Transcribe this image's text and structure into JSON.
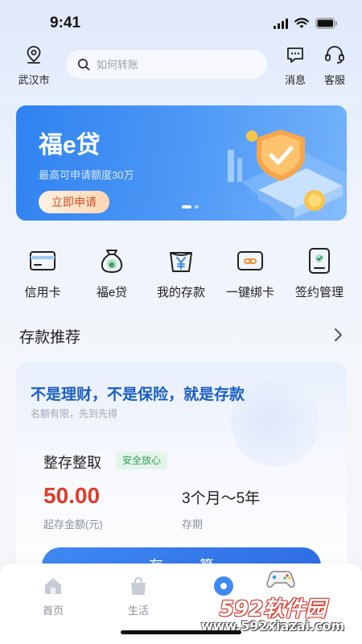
{
  "status_bar": {
    "time": "9:41"
  },
  "header": {
    "location_label": "武汉市",
    "search_placeholder": "如何转账",
    "messages_label": "消息",
    "service_label": "客服"
  },
  "banner": {
    "title": "福e贷",
    "subtitle": "最高可申请额度30万",
    "button_label": "立即申请",
    "slide_count": 2,
    "active_slide": 1
  },
  "quick_actions": [
    {
      "label": "信用卡",
      "icon": "credit-card-icon"
    },
    {
      "label": "福e贷",
      "icon": "money-bag-icon"
    },
    {
      "label": "我的存款",
      "icon": "yuan-deposit-icon"
    },
    {
      "label": "一键绑卡",
      "icon": "link-card-icon"
    },
    {
      "label": "签约管理",
      "icon": "contract-management-icon"
    }
  ],
  "deposit_section": {
    "title": "存款推荐",
    "more_icon": "chevron-right-icon",
    "slogan": "不是理财，不是保险，就是存款",
    "slogan_sub": "名额有限，先到先得",
    "product_name": "整存整取",
    "product_tag": "安全放心",
    "amount": "50.00",
    "amount_label": "起存金额(元)",
    "term": "3个月～5年",
    "term_label": "存期",
    "button_label": "存 算"
  },
  "tabbar": {
    "tabs": [
      {
        "label": "首页",
        "icon": "home-icon"
      },
      {
        "label": "生活",
        "icon": "shopping-bag-icon"
      }
    ]
  },
  "watermark": {
    "brand": "592软件园",
    "url": "www.592xiazai.com"
  },
  "colors": {
    "primary_blue": "#2f7ff0",
    "slogan_blue": "#1b5fc2",
    "amount_red": "#e03b2b",
    "tag_green": "#2f9e58"
  }
}
